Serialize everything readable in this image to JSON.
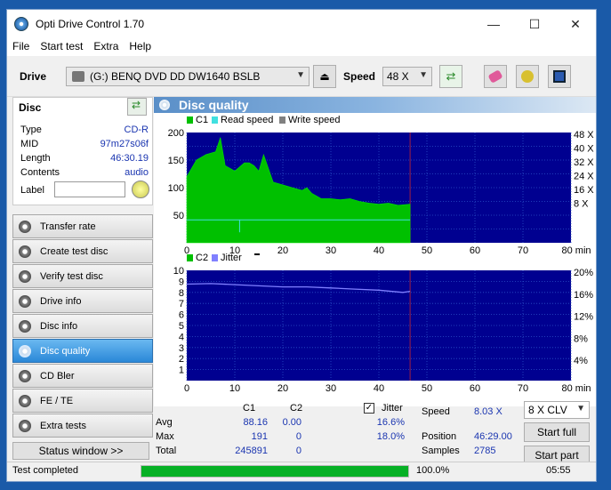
{
  "window": {
    "title": "Opti Drive Control 1.70",
    "minimize": "—",
    "maximize": "☐",
    "close": "✕"
  },
  "menu": [
    "File",
    "Start test",
    "Extra",
    "Help"
  ],
  "drivebar": {
    "drive_label": "Drive",
    "drive_value": "(G:)   BENQ DVD DD DW1640 BSLB",
    "speed_label": "Speed",
    "speed_value": "48 X"
  },
  "disc": {
    "title": "Disc",
    "rows": [
      {
        "label": "Type",
        "value": "CD-R"
      },
      {
        "label": "MID",
        "value": "97m27s06f"
      },
      {
        "label": "Length",
        "value": "46:30.19"
      },
      {
        "label": "Contents",
        "value": "audio"
      }
    ],
    "label_label": "Label"
  },
  "nav": [
    "Transfer rate",
    "Create test disc",
    "Verify test disc",
    "Drive info",
    "Disc info",
    "Disc quality",
    "CD Bler",
    "FE / TE",
    "Extra tests"
  ],
  "nav_active": "Disc quality",
  "status_window": "Status window >>",
  "panel_title": "Disc quality",
  "chart_data": [
    {
      "type": "area",
      "legend": [
        "C1",
        "Read speed",
        "Write speed"
      ],
      "legend_colors": [
        "#00c000",
        "#40e0e0",
        "#808080"
      ],
      "x_ticks": [
        "0",
        "10",
        "20",
        "30",
        "40",
        "50",
        "60",
        "70",
        "80 min"
      ],
      "y_left_ticks": [
        "200",
        "150",
        "100",
        "50"
      ],
      "y_right_ticks": [
        "48 X",
        "40 X",
        "32 X",
        "24 X",
        "16 X",
        "8 X"
      ],
      "xlim": [
        0,
        80
      ],
      "ylim": [
        0,
        200
      ],
      "series": [
        {
          "name": "C1",
          "x": [
            0,
            2,
            4,
            6,
            7,
            8,
            9,
            10,
            12,
            13,
            14,
            15,
            16,
            18,
            20,
            22,
            24,
            25,
            26,
            28,
            30,
            32,
            34,
            36,
            38,
            40,
            42,
            44,
            46.5
          ],
          "values": [
            120,
            150,
            160,
            165,
            191,
            140,
            135,
            130,
            145,
            145,
            140,
            130,
            160,
            110,
            105,
            100,
            95,
            100,
            90,
            80,
            80,
            78,
            80,
            75,
            72,
            70,
            72,
            68,
            70
          ]
        },
        {
          "name": "Read speed",
          "x": [
            0,
            46.5
          ],
          "values": [
            8.03,
            8.03
          ]
        }
      ]
    },
    {
      "type": "line",
      "legend": [
        "C2",
        "Jitter"
      ],
      "legend_colors": [
        "#00c000",
        "#8080ff"
      ],
      "x_ticks": [
        "0",
        "10",
        "20",
        "30",
        "40",
        "50",
        "60",
        "70",
        "80 min"
      ],
      "y_left_ticks": [
        "10",
        "9",
        "8",
        "7",
        "6",
        "5",
        "4",
        "3",
        "2",
        "1"
      ],
      "y_right_ticks": [
        "20%",
        "16%",
        "12%",
        "8%",
        "4%"
      ],
      "xlim": [
        0,
        80
      ],
      "ylim": [
        0,
        10
      ],
      "series": [
        {
          "name": "Jitter",
          "x": [
            0,
            5,
            10,
            15,
            20,
            25,
            30,
            35,
            40,
            45,
            46.5
          ],
          "values": [
            17.5,
            17.6,
            17.4,
            17.2,
            17.0,
            17.0,
            16.8,
            16.6,
            16.4,
            16.0,
            16.2
          ]
        }
      ]
    }
  ],
  "stats": {
    "headers": [
      "C1",
      "C2"
    ],
    "rows": [
      {
        "label": "Avg",
        "c1": "88.16",
        "c2": "0.00",
        "jitter": "16.6%"
      },
      {
        "label": "Max",
        "c1": "191",
        "c2": "0",
        "jitter": "18.0%"
      },
      {
        "label": "Total",
        "c1": "245891",
        "c2": "0",
        "jitter": ""
      }
    ],
    "jitter_label": "Jitter",
    "speed_label": "Speed",
    "speed_value": "8.03 X",
    "position_label": "Position",
    "position_value": "46:29.00",
    "samples_label": "Samples",
    "samples_value": "2785",
    "clv_value": "8 X CLV",
    "start_full": "Start full",
    "start_part": "Start part"
  },
  "statusbar": {
    "text": "Test completed",
    "progress": 1.0,
    "progress_text": "100.0%",
    "time": "05:55"
  }
}
